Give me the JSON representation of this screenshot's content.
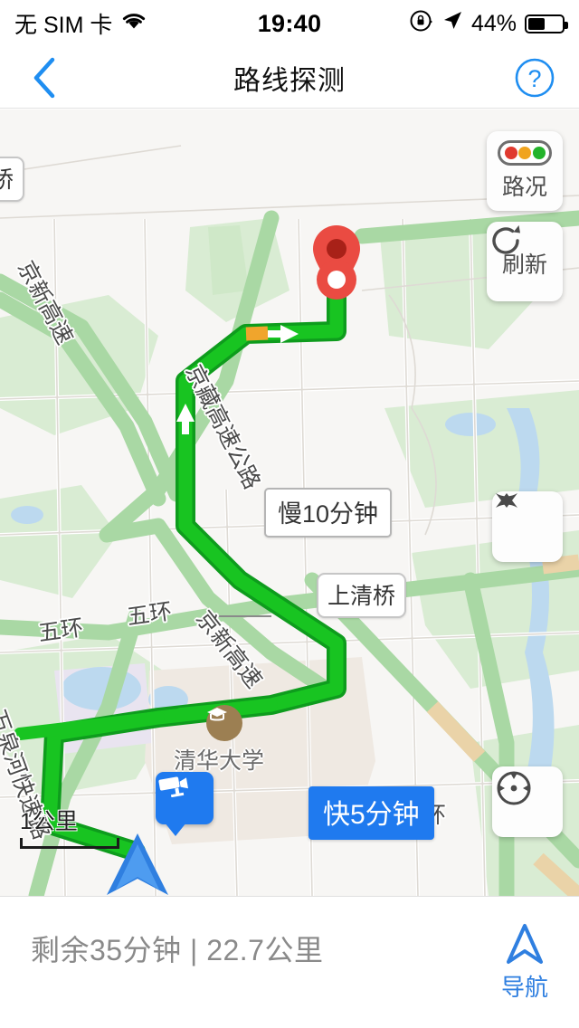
{
  "status_bar": {
    "carrier": "无 SIM 卡",
    "wifi_icon": "wifi-icon",
    "time": "19:40",
    "rotation_lock_icon": "rotation-lock-icon",
    "location_icon": "location-arrow-icon",
    "battery_percent": "44%",
    "battery_level": 44
  },
  "header": {
    "back_icon": "chevron-left-icon",
    "title": "路线探测",
    "help_icon": "question-mark-icon",
    "accent_color": "#1f7aef"
  },
  "map": {
    "controls": [
      {
        "name": "traffic-button",
        "icon": "traffic-light-icon",
        "label": "路况"
      },
      {
        "name": "refresh-button",
        "icon": "refresh-icon",
        "label": "刷新"
      }
    ],
    "zoom_control": {
      "name": "zoom-stepper",
      "up_icon": "triangle-up-icon",
      "down_icon": "triangle-down-icon"
    },
    "locate_control": {
      "name": "locate-button",
      "icon": "locate-target-icon"
    },
    "scale": {
      "label": "1公里"
    },
    "route_badges": [
      {
        "name": "slower-route-badge",
        "text": "慢10分钟",
        "style": "white"
      },
      {
        "name": "faster-route-badge",
        "text": "快5分钟",
        "style": "blue",
        "color": "#1f7aef"
      }
    ],
    "place_labels": [
      {
        "name": "map-label-bridge-left",
        "text": "桥"
      },
      {
        "name": "map-label-shangqing-bridge",
        "text": "上清桥"
      }
    ],
    "road_labels": [
      {
        "name": "road-label-jingxin-expressway-nw",
        "text": "京新高速"
      },
      {
        "name": "road-label-jingzang-expressway",
        "text": "京藏高速公路"
      },
      {
        "name": "road-label-fifth-ring-west",
        "text": "五环"
      },
      {
        "name": "road-label-fifth-ring-mid",
        "text": "五环"
      },
      {
        "name": "road-label-jingxin-expressway-s",
        "text": "京新高速"
      },
      {
        "name": "road-label-wanquanhe-expressway",
        "text": "万泉河快速路"
      },
      {
        "name": "road-label-ring-east",
        "text": "环"
      }
    ],
    "poi": [
      {
        "name": "poi-tsinghua-university",
        "text": "清华大学",
        "icon": "graduation-cap-icon"
      }
    ],
    "markers": [
      {
        "name": "destination-pin",
        "icon": "map-pin-icon",
        "color": "#e8473f"
      },
      {
        "name": "speed-camera-marker",
        "icon": "camera-icon",
        "color": "#1f7aef"
      },
      {
        "name": "user-location-arrow",
        "icon": "navigation-arrow-icon",
        "color": "#2f7fe0"
      }
    ],
    "route_colors": {
      "active_route": "#16b526",
      "alternate_route": "#a6dba6",
      "congestion": "#f5a623"
    }
  },
  "bottom_bar": {
    "eta_text": "剩余35分钟 | 22.7公里",
    "nav_icon": "navigation-arrow-icon",
    "nav_label": "导航"
  }
}
